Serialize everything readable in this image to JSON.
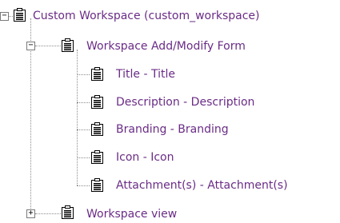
{
  "colors": {
    "label": "#6a2c86",
    "connector": "#8c8c8c"
  },
  "tree": {
    "root": {
      "label": "Custom Workspace (custom_workspace)",
      "icon": "document-icon",
      "toggle": "⊟",
      "expanded": true
    },
    "form": {
      "label": "Workspace Add/Modify Form",
      "icon": "document-icon",
      "toggle": "⊟",
      "expanded": true,
      "fields": [
        {
          "label": "Title - Title",
          "icon": "document-icon"
        },
        {
          "label": "Description - Description",
          "icon": "document-icon"
        },
        {
          "label": "Branding - Branding",
          "icon": "document-icon"
        },
        {
          "label": "Icon - Icon",
          "icon": "document-icon"
        },
        {
          "label": "Attachment(s) - Attachment(s)",
          "icon": "document-icon"
        }
      ]
    },
    "view": {
      "label": "Workspace view",
      "icon": "document-icon",
      "toggle": "⊞",
      "expanded": false
    }
  }
}
